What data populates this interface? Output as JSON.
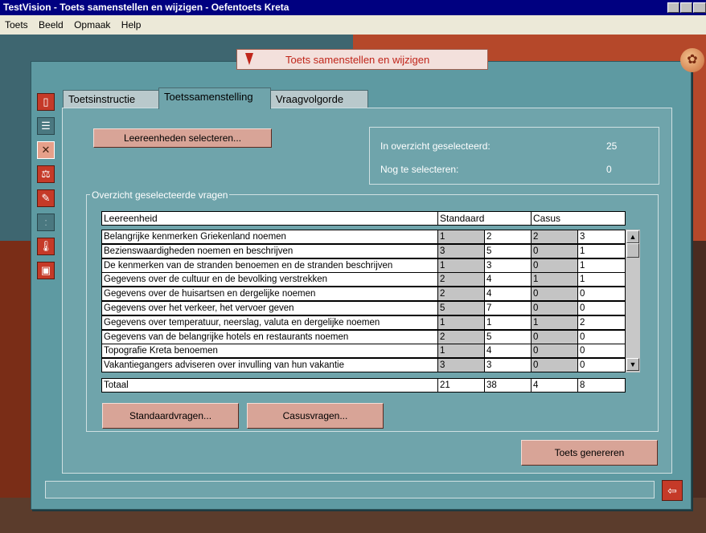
{
  "window": {
    "title": "TestVision - Toets samenstellen en wijzigen - Oefentoets Kreta"
  },
  "menu": [
    "Toets",
    "Beeld",
    "Opmaak",
    "Help"
  ],
  "banner": {
    "title": "Toets samenstellen en wijzigen"
  },
  "tools": [
    "document-icon",
    "list-icon",
    "tools-icon",
    "scale-icon",
    "edit-icon",
    "info-icon",
    "thermometer-icon",
    "save-icon"
  ],
  "tabs": [
    "Toetsinstructie",
    "Toetssamenstelling",
    "Vraagvolgorde"
  ],
  "active_tab": "Toetssamenstelling",
  "buttons": {
    "select_units": "Leereenheden selecteren...",
    "standard_questions": "Standaardvragen...",
    "case_questions": "Casusvragen...",
    "generate": "Toets genereren"
  },
  "info": {
    "selected_label": "In overzicht geselecteerd:",
    "selected_value": "25",
    "remaining_label": "Nog te selecteren:",
    "remaining_value": "0"
  },
  "overview": {
    "legend": "Overzicht geselecteerde vragen",
    "headers": [
      "Leereenheid",
      "Standaard",
      "Casus"
    ],
    "rows": [
      {
        "name": "Belangrijke kenmerken Griekenland noemen",
        "v": [
          "1",
          "2",
          "2",
          "3"
        ]
      },
      {
        "name": "Bezienswaardigheden noemen en beschrijven",
        "v": [
          "3",
          "5",
          "0",
          "1"
        ]
      },
      {
        "name": "De kenmerken van de stranden benoemen en de stranden beschrijven",
        "v": [
          "1",
          "3",
          "0",
          "1"
        ]
      },
      {
        "name": "Gegevens over de cultuur en de bevolking verstrekken",
        "v": [
          "2",
          "4",
          "1",
          "1"
        ]
      },
      {
        "name": "Gegevens over de huisartsen en dergelijke noemen",
        "v": [
          "2",
          "4",
          "0",
          "0"
        ]
      },
      {
        "name": "Gegevens over het verkeer, het vervoer geven",
        "v": [
          "5",
          "7",
          "0",
          "0"
        ]
      },
      {
        "name": "Gegevens over temperatuur, neerslag, valuta en dergelijke noemen",
        "v": [
          "1",
          "1",
          "1",
          "2"
        ]
      },
      {
        "name": "Gegevens van de belangrijke hotels en restaurants noemen",
        "v": [
          "2",
          "5",
          "0",
          "0"
        ]
      },
      {
        "name": "Topografie Kreta benoemen",
        "v": [
          "1",
          "4",
          "0",
          "0"
        ]
      },
      {
        "name": "Vakantiegangers adviseren over invulling van hun vakantie",
        "v": [
          "3",
          "3",
          "0",
          "0"
        ]
      }
    ],
    "total": {
      "label": "Totaal",
      "v": [
        "21",
        "38",
        "4",
        "8"
      ]
    }
  },
  "colors": {
    "titlebar": "#000080",
    "panel": "#5e9aa2",
    "content": "#6fa4ab",
    "button": "#d8a497",
    "accent": "#c53a28"
  }
}
